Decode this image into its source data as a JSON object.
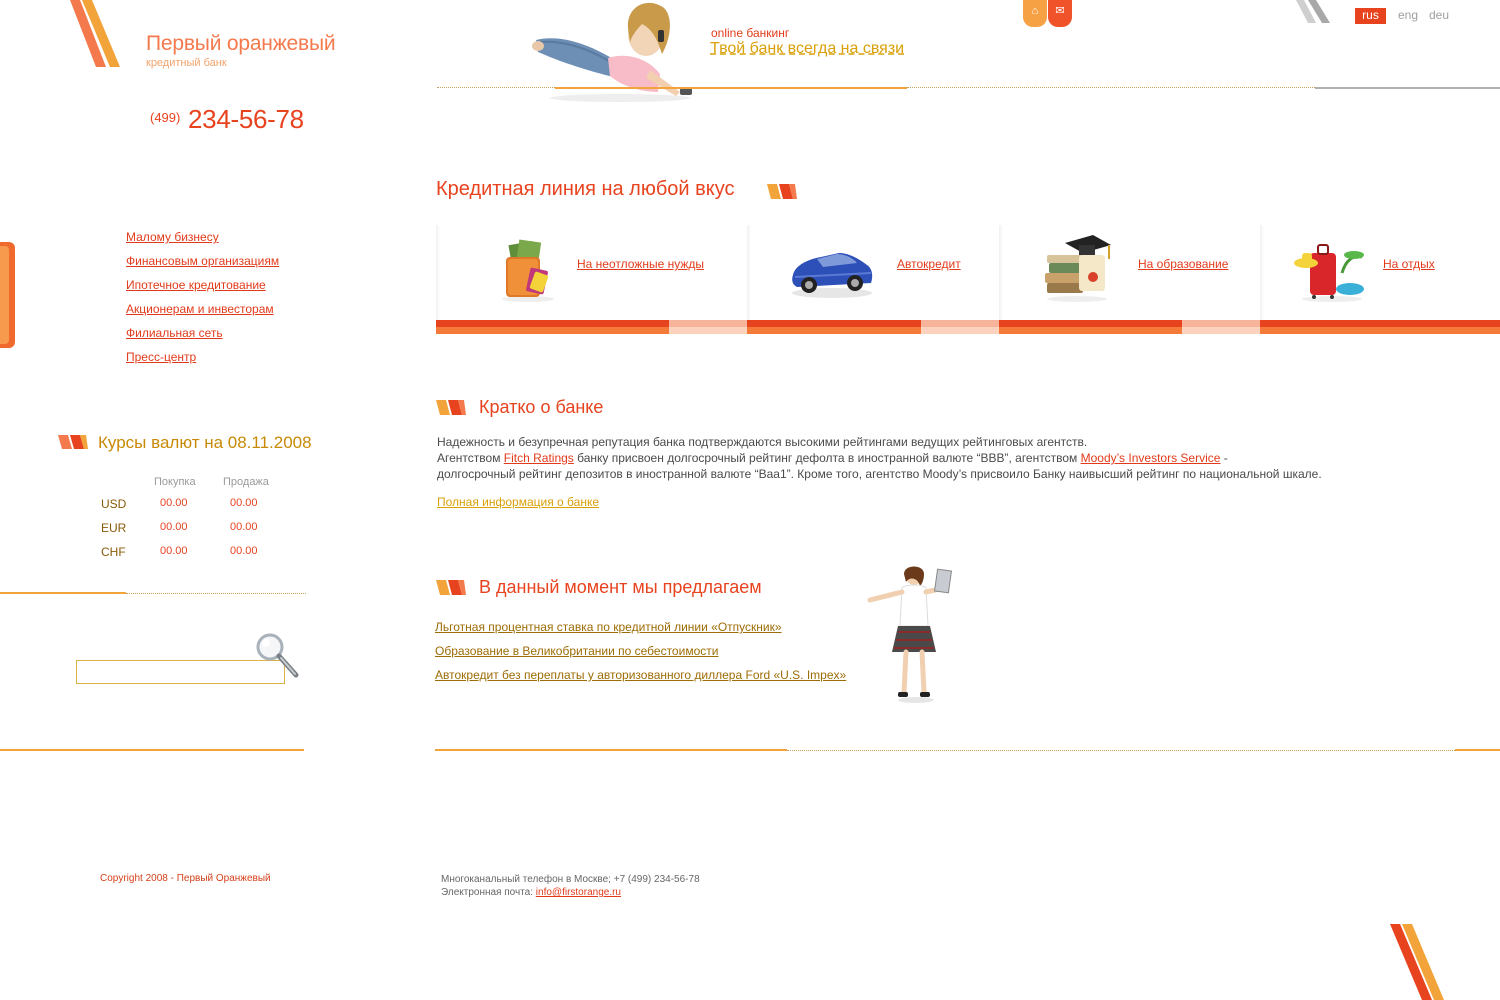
{
  "brand": {
    "name": "Первый оранжевый",
    "subtitle": "кредитный банк",
    "phone_code": "(499)",
    "phone_number": "234-56-78"
  },
  "colors": {
    "primary": "#e8431f",
    "accent_orange": "#f47a4d",
    "gold": "#d9a00a",
    "light_pink": "#f8b49a"
  },
  "header": {
    "online_label": "online банкинг",
    "online_slogan": "Твой банк всегда на связи",
    "home_icon": "home-icon",
    "mail_icon": "mail-icon",
    "languages": [
      "rus",
      "eng",
      "deu"
    ],
    "active_language": "rus"
  },
  "left_nav": [
    "Малому бизнесу",
    "Финансовым организациям",
    "Ипотечное кредитование",
    "Акционерам и инвесторам",
    "Филиальная сеть",
    "Пресс-центр"
  ],
  "rates": {
    "title": "Курсы валют на 08.11.2008",
    "buy_label": "Покупка",
    "sell_label": "Продажа",
    "rows": [
      {
        "currency": "USD",
        "buy": "00.00",
        "sell": "00.00"
      },
      {
        "currency": "EUR",
        "buy": "00.00",
        "sell": "00.00"
      },
      {
        "currency": "CHF",
        "buy": "00.00",
        "sell": "00.00"
      }
    ]
  },
  "search": {
    "value": "",
    "icon": "magnifier-icon"
  },
  "credit": {
    "title": "Кредитная линия на любой вкус",
    "cards": [
      {
        "label": "На неотложные нужды",
        "icon": "wallet-icon"
      },
      {
        "label": "Автокредит",
        "icon": "car-icon"
      },
      {
        "label": "На образование",
        "icon": "graduation-icon"
      },
      {
        "label": "На отдых",
        "icon": "suitcase-icon"
      }
    ]
  },
  "about": {
    "title": "Кратко о банке",
    "line1": "Надежность и безупречная репутация банка подтверждаются высокими рейтингами ведущих рейтинговых агентств.",
    "line2_prefix": "Агентством ",
    "fitch": "Fitch Ratings",
    "line2_middle": " банку присвоен долгосрочный рейтинг дефолта в иностранной валюте “BBB”, агентством ",
    "moodys": "Moody’s Investors Service",
    "line2_suffix": " -",
    "line3": "долгосрочный рейтинг депозитов в иностранной валюте “Baa1”. Кроме того, агентство Moody’s присвоило Банку наивысший рейтинг по национальной шкале.",
    "more_link": "Полная информация о банке"
  },
  "offers": {
    "title": "В данный момент мы предлагаем",
    "items": [
      "Льготная процентная ставка по кредитной линии «Отпускник»",
      "Образование в Великобритании по себестоимости",
      "Автокредит без переплаты у авторизованного диллера Ford «U.S. Impex»"
    ]
  },
  "footer": {
    "copyright": "Copyright 2008 - Первый Оранжевый",
    "phone_line": "Многоканальный телефон в Москве; +7 (499) 234-56-78",
    "email_label": "Электронная почта: ",
    "email": "info@firstorange.ru"
  }
}
